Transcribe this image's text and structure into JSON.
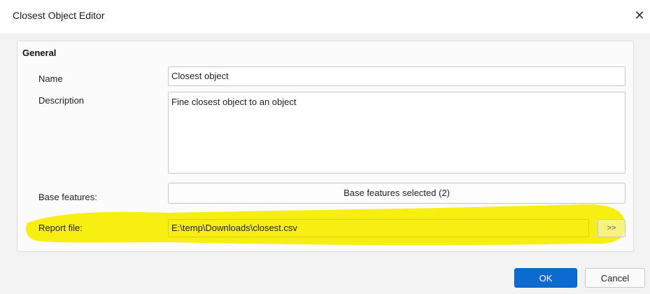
{
  "window": {
    "title": "Closest Object Editor",
    "close_glyph": "✕"
  },
  "general": {
    "section_title": "General",
    "name_label": "Name",
    "name_value": "Closest object",
    "description_label": "Description",
    "description_value": "Fine closest object to an object",
    "base_features_label": "Base features:",
    "base_features_button": "Base features selected (2)",
    "report_file_label": "Report file:",
    "report_file_value": "E:\\temp\\Downloads\\closest.csv",
    "browse_button": ">>"
  },
  "footer": {
    "ok_label": "OK",
    "cancel_label": "Cancel"
  },
  "colors": {
    "highlight": "#f6ee00",
    "ok_button": "#0c6bd0"
  }
}
